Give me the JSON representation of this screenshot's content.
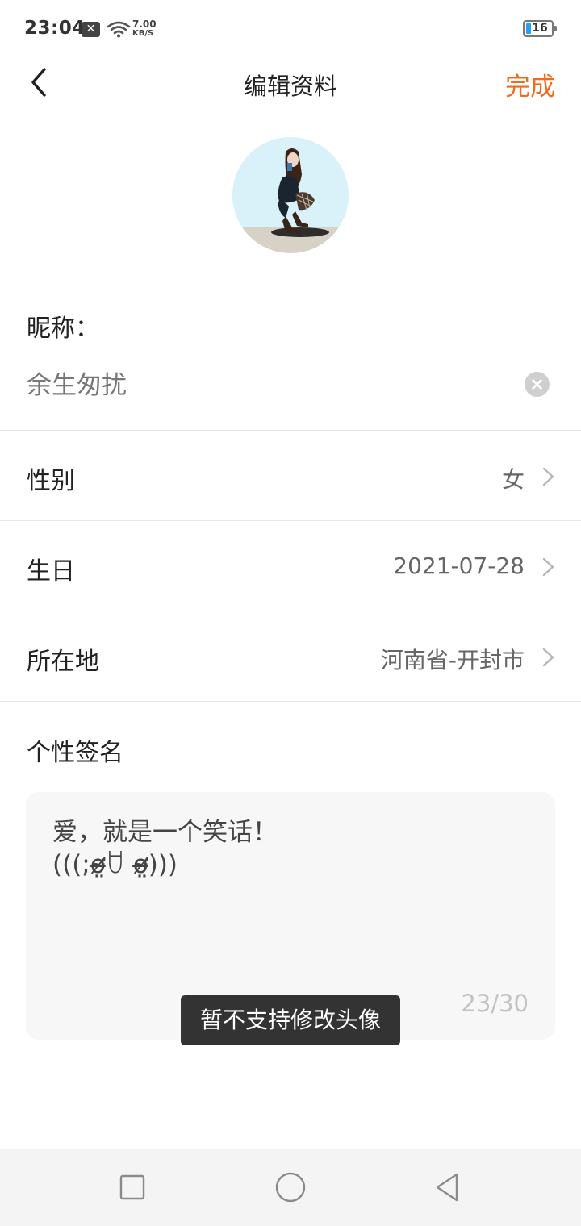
{
  "status_bar": {
    "time": "23:04",
    "notification_icon": "close-box-icon",
    "net_speed": "7.00",
    "net_speed_unit": "KB/S",
    "battery_level": "16",
    "battery_color": "#2a9df4"
  },
  "header": {
    "back_icon": "chevron-left-icon",
    "title": "编辑资料",
    "done_label": "完成",
    "accent_color": "#f26a1b"
  },
  "profile": {
    "nickname_label": "昵称：",
    "nickname_value": "余生匆扰",
    "rows": [
      {
        "label": "性别",
        "value": "女"
      },
      {
        "label": "生日",
        "value": "2021-07-28"
      },
      {
        "label": "所在地",
        "value": "河南省-开封市"
      }
    ],
    "signature_label": "个性签名",
    "signature_text": "爱，就是一个笑话！\n(((;ơ̴̶̷̤ꇴ ơ̴̶̷̤))) ",
    "signature_count": "23/30"
  },
  "toast": {
    "message": "暂不支持修改头像"
  },
  "nav": {
    "recents_icon": "square-icon",
    "home_icon": "circle-icon",
    "back_icon": "triangle-back-icon"
  }
}
